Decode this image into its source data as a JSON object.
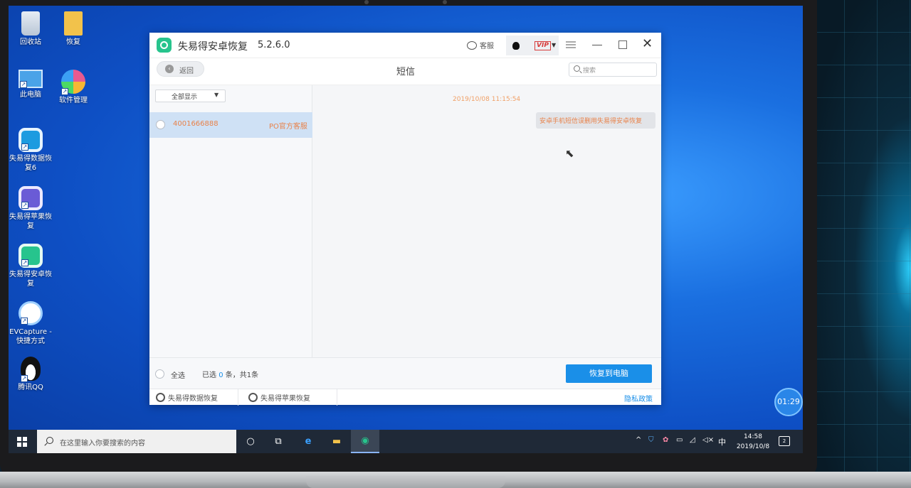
{
  "desktop": {
    "icons": [
      {
        "label": "回收站",
        "color": "#cfd8e3"
      },
      {
        "label": "恢复",
        "color": "#f2c24b"
      },
      {
        "label": "此电脑",
        "color": "#4aa3e8"
      },
      {
        "label": "软件管理",
        "color": "#e85a8f"
      },
      {
        "label": "失易得数据恢复6",
        "color": "#1c9be0"
      },
      {
        "label": "失易得苹果恢复",
        "color": "#6a5bd6"
      },
      {
        "label": "失易得安卓恢复",
        "color": "#27c48d"
      },
      {
        "label": "EVCapture - 快捷方式",
        "color": "#ffffff"
      },
      {
        "label": "腾讯QQ",
        "color": "#111111"
      }
    ]
  },
  "app": {
    "name": "失易得安卓恢复",
    "version": "5.2.6.0",
    "service_label": "客服",
    "vip_label": "VIP",
    "back_label": "返回",
    "section_title": "短信",
    "search_placeholder": "搜索",
    "filter_label": "全部显示",
    "conversations": [
      {
        "number": "4001666888",
        "sender": "PO官方客服"
      }
    ],
    "message": {
      "time": "2019/10/08 11:15:54",
      "text": "安卓手机短信误删用失易得安卓恢复"
    },
    "footer": {
      "select_all": "全选",
      "selected_prefix": "已选",
      "selected_count": "0",
      "selected_suffix": "条，共1条",
      "restore_button": "恢复到电脑"
    },
    "bottom": {
      "link1": "失易得数据恢复",
      "link2": "失易得苹果恢复",
      "privacy": "隐私政策"
    }
  },
  "overlay_timer": "01:29",
  "taskbar": {
    "search_placeholder": "在这里输入你要搜索的内容",
    "ime": "中",
    "time": "14:58",
    "date": "2019/10/8",
    "notifications": "2"
  },
  "colors": {
    "accent": "#1a8fe8",
    "orange_text": "#e8824a",
    "brand_green": "#27c48d"
  }
}
